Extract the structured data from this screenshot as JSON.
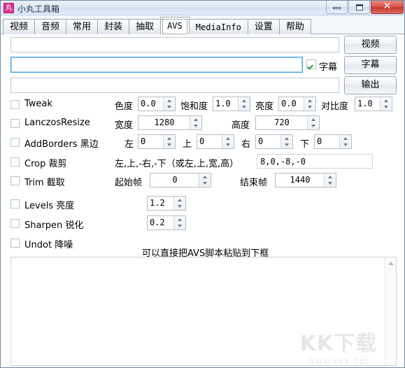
{
  "window": {
    "title": "小丸工具箱",
    "icon_label": "丸",
    "controls": {
      "minimize": "minimize",
      "maximize": "maximize",
      "close": "✕"
    }
  },
  "tabs": [
    {
      "label": "视频",
      "active": false,
      "mono": false
    },
    {
      "label": "音频",
      "active": false,
      "mono": false
    },
    {
      "label": "常用",
      "active": false,
      "mono": false
    },
    {
      "label": "封装",
      "active": false,
      "mono": false
    },
    {
      "label": "抽取",
      "active": false,
      "mono": false
    },
    {
      "label": "AVS",
      "active": true,
      "mono": true
    },
    {
      "label": "MediaInfo",
      "active": false,
      "mono": true
    },
    {
      "label": "设置",
      "active": false,
      "mono": false
    },
    {
      "label": "帮助",
      "active": false,
      "mono": false
    }
  ],
  "files": {
    "video_path": "",
    "subtitle_path": "",
    "output_path": "",
    "subtitle_checkbox_label": "字幕",
    "subtitle_checked": true,
    "video_button": "视频",
    "subtitle_button": "字幕",
    "output_button": "输出"
  },
  "filters": {
    "tweak": {
      "label": "Tweak",
      "checked": false,
      "fields": [
        {
          "label": "色度",
          "value": "0.0"
        },
        {
          "label": "饱和度",
          "value": "1.0"
        },
        {
          "label": "亮度",
          "value": "0.0"
        },
        {
          "label": "对比度",
          "value": "1.0"
        }
      ]
    },
    "resize": {
      "label": "LanczosResize",
      "checked": false,
      "fields": [
        {
          "label": "宽度",
          "value": "1280"
        },
        {
          "label": "高度",
          "value": "720"
        }
      ]
    },
    "addborders": {
      "label": "AddBorders 黑边",
      "checked": false,
      "fields": [
        {
          "label": "左",
          "value": "0"
        },
        {
          "label": "上",
          "value": "0"
        },
        {
          "label": "右",
          "value": "0"
        },
        {
          "label": "下",
          "value": "0"
        }
      ]
    },
    "crop": {
      "label": "Crop 裁剪",
      "checked": false,
      "hint": "左,上,-右,-下（或左,上,宽,高）",
      "value": "8,0,-8,-0"
    },
    "trim": {
      "label": "Trim 截取",
      "checked": false,
      "fields": [
        {
          "label": "起始帧",
          "value": "0"
        },
        {
          "label": "结束帧",
          "value": "1440"
        }
      ]
    },
    "levels": {
      "label": "Levels 亮度",
      "checked": false,
      "value": "1.2"
    },
    "sharpen": {
      "label": "Sharpen 锐化",
      "checked": false,
      "value": "0.2"
    },
    "undot": {
      "label": "Undot 降噪",
      "checked": false
    }
  },
  "script": {
    "hint": "可以直接把AVS脚本粘贴到下框",
    "content": ""
  },
  "watermark": {
    "main": "KK下载",
    "sub": "www.kkx.net"
  },
  "colors": {
    "titlebar_accent": "#d9318f",
    "close_button": "#c2392f",
    "focus_border": "#4aa3df",
    "check_green": "#2e9b33"
  }
}
